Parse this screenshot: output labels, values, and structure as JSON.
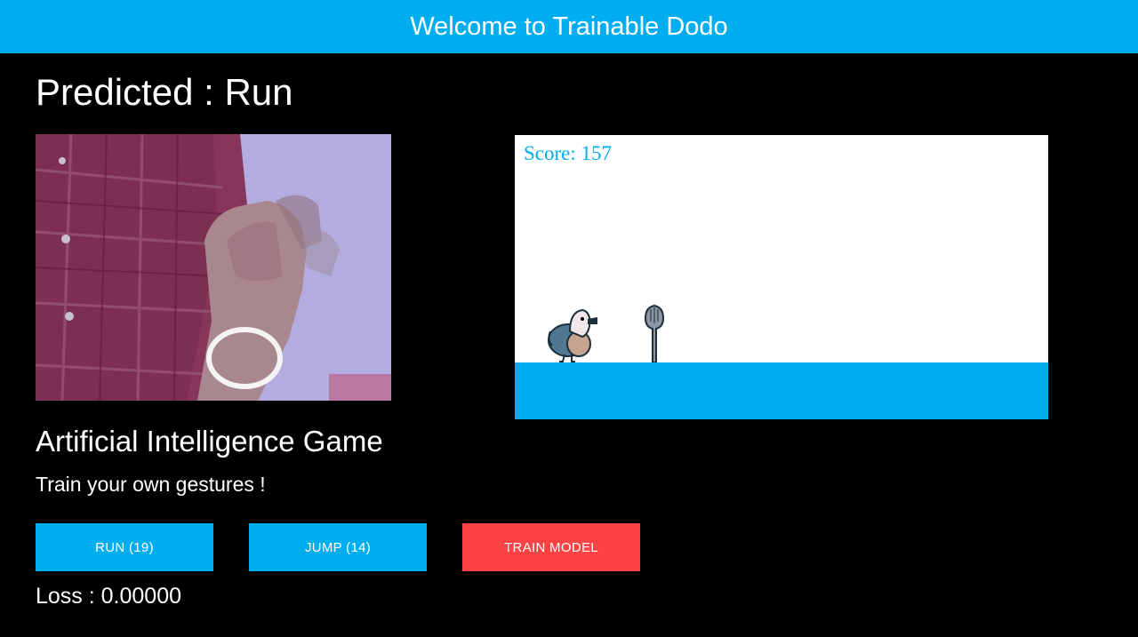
{
  "header": {
    "title": "Welcome to Trainable Dodo"
  },
  "prediction": {
    "text": "Predicted : Run"
  },
  "webcam": {
    "icon": "webcam-feed"
  },
  "game": {
    "score_text": "Score: 157",
    "ground_color": "#00adef",
    "sprites": [
      "dodo-icon",
      "spoon-obstacle-icon"
    ]
  },
  "info": {
    "title": "Artificial Intelligence Game",
    "subtitle": "Train your own gestures !"
  },
  "buttons": {
    "run_label": "RUN (19)",
    "jump_label": "JUMP (14)",
    "train_label": "TRAIN MODEL"
  },
  "stats": {
    "loss_text": "Loss : 0.00000"
  },
  "colors": {
    "accent": "#00adef",
    "train": "#fc4343",
    "background": "#000000"
  }
}
